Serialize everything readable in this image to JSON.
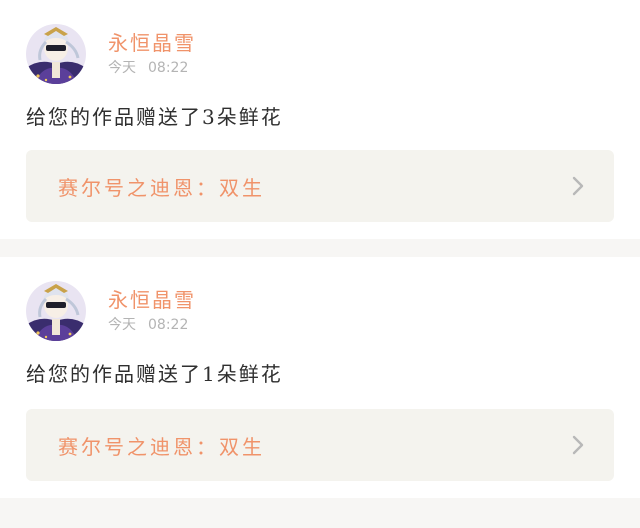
{
  "colors": {
    "accent": "#f0936a",
    "text": "#2f2f2f",
    "muted": "#b4b4b4",
    "link_bg": "#f4f3ee",
    "page_bg": "#f7f6f4"
  },
  "notifications": [
    {
      "username": "永恒晶雪",
      "date": "今天",
      "time": "08:22",
      "message": "给您的作品赠送了3朵鲜花",
      "work_title": "赛尔号之迪恩：双生",
      "chevron_icon": "chevron-right-icon"
    },
    {
      "username": "永恒晶雪",
      "date": "今天",
      "time": "08:22",
      "message": "给您的作品赠送了1朵鲜花",
      "work_title": "赛尔号之迪恩：双生",
      "chevron_icon": "chevron-right-icon"
    }
  ]
}
